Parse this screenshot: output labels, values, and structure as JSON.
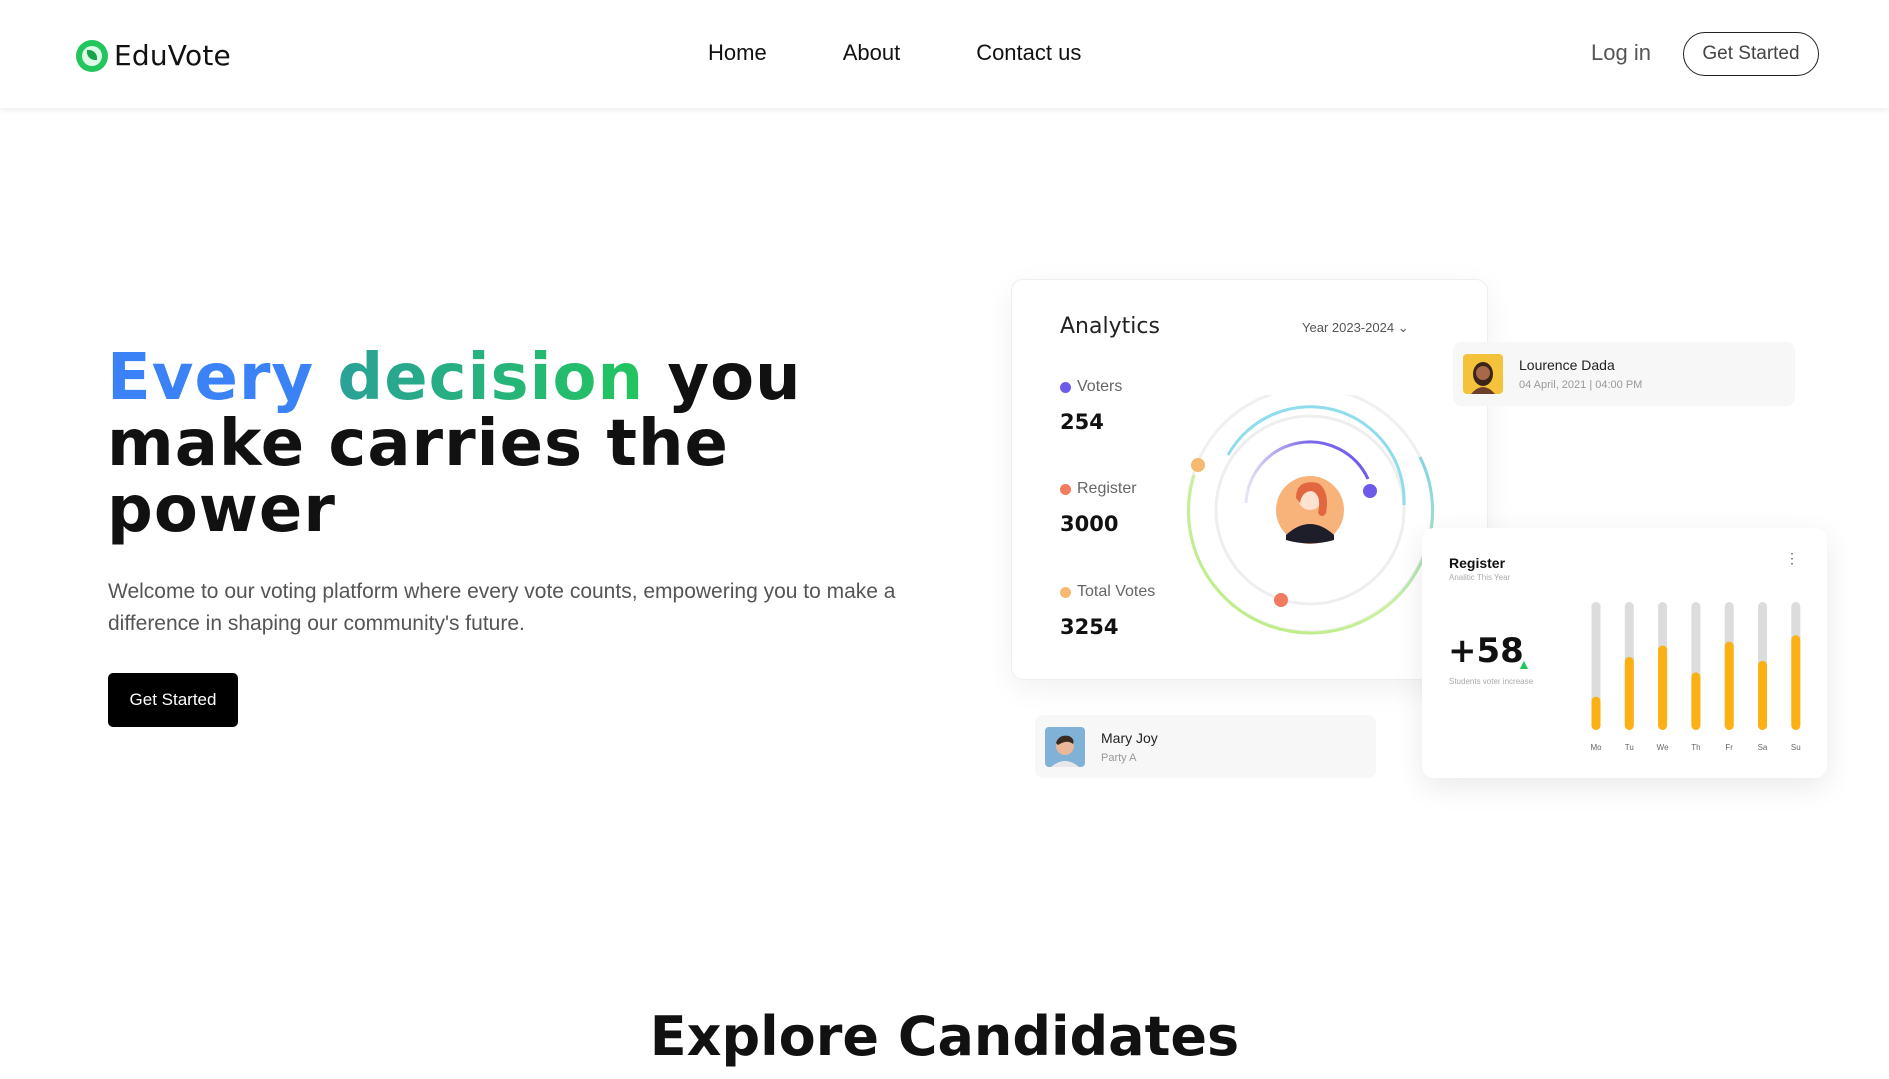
{
  "nav": {
    "brand": "EduVote",
    "links": [
      "Home",
      "About",
      "Contact us"
    ],
    "login": "Log in",
    "cta": "Get Started"
  },
  "hero": {
    "title_every": "Every",
    "title_decision": "decision",
    "title_rest": "you make carries the power",
    "subtitle": "Welcome to our voting platform where every vote counts, empowering you to make a difference in shaping our community's future.",
    "cta": "Get Started"
  },
  "analytics": {
    "title": "Analytics",
    "period": "Year 2023-2024",
    "stats": [
      {
        "label": "Voters",
        "value": "254",
        "color": "#6d5bea"
      },
      {
        "label": "Register",
        "value": "3000",
        "color": "#f47b5f"
      },
      {
        "label": "Total Votes",
        "value": "3254",
        "color": "#f5b971"
      }
    ]
  },
  "person_cards": [
    {
      "name": "Lourence Dada",
      "detail": "04 April, 2021 | 04:00 PM"
    },
    {
      "name": "Mary Joy",
      "detail": "Party A"
    }
  ],
  "register": {
    "title": "Register",
    "subtitle": "Analitic This Year",
    "menu_icon": "more-vertical-icon",
    "value": "+58",
    "note": "Students voter increase"
  },
  "chart_data": {
    "type": "bar",
    "categories": [
      "Mo",
      "Tu",
      "We",
      "Th",
      "Fr",
      "Sa",
      "Su"
    ],
    "values": [
      26,
      57,
      66,
      45,
      69,
      54,
      74
    ],
    "ylim": [
      0,
      100
    ],
    "color": "#fbb014",
    "track_color": "#dcdcdc"
  },
  "sections": {
    "candidates_title": "Explore Candidates"
  }
}
